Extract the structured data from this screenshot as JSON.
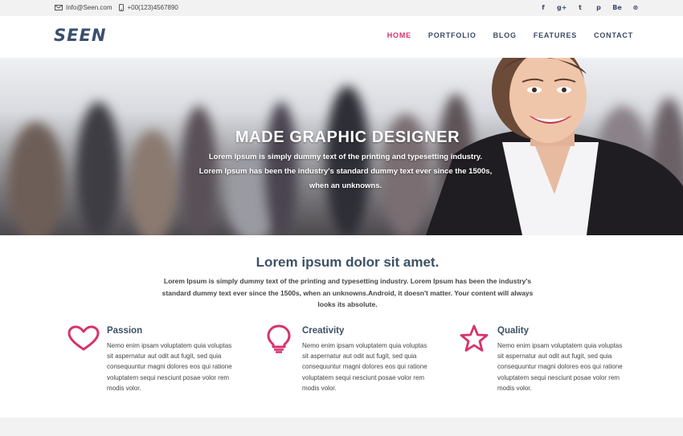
{
  "topbar": {
    "email": "Info@Seen.com",
    "phone": "+00(123)4567890",
    "social": [
      {
        "icon": "facebook-icon",
        "glyph": "f"
      },
      {
        "icon": "google-plus-icon",
        "glyph": "g+"
      },
      {
        "icon": "twitter-icon",
        "glyph": "t"
      },
      {
        "icon": "pinterest-icon",
        "glyph": "p"
      },
      {
        "icon": "behance-icon",
        "glyph": "Be"
      },
      {
        "icon": "dribbble-icon",
        "glyph": "⊛"
      }
    ]
  },
  "header": {
    "logo": "SEEN",
    "nav": [
      "HOME",
      "PORTFOLIO",
      "BLOG",
      "FEATURES",
      "CONTACT"
    ],
    "active_nav": "HOME"
  },
  "hero": {
    "title": "MADE GRAPHIC DESIGNER",
    "line1": "Lorem Ipsum is simply dummy text of the printing and typesetting industry.",
    "line2": "Lorem Ipsum has been the industry's standard dummy text ever since the 1500s,",
    "line3": "when an unknowns."
  },
  "intro": {
    "title": "Lorem ipsum dolor sit amet.",
    "text": "Lorem Ipsum is simply dummy text of the printing and typesetting industry. Lorem Ipsum has been the industry's standard dummy text ever since the 1500s, when an unknowns.Android, it doesn't matter. Your content will always looks its absolute."
  },
  "features": [
    {
      "title": "Passion",
      "icon": "heart-icon",
      "text": "Nemo enim ipsam voluptatem quia voluptas sit aspernatur aut odit aut fugit, sed quia consequuntur magni dolores eos qui ratione voluptatem sequi nesciunt posae volor rem modis volor."
    },
    {
      "title": "Creativity",
      "icon": "lightbulb-icon",
      "text": "Nemo enim ipsam voluptatem quia voluptas sit aspernatur aut odit aut fugit, sed quia consequuntur magni dolores eos qui ratione voluptatem sequi nesciunt posae volor rem modis volor."
    },
    {
      "title": "Quality",
      "icon": "star-icon",
      "text": "Nemo enim ipsam voluptatem quia voluptas sit aspernatur aut odit aut fugit, sed quia consequuntur magni dolores eos qui ratione voluptatem sequi nesciunt posae volor rem modis volor."
    }
  ],
  "colors": {
    "accent": "#d6336c",
    "heading": "#3d5066",
    "nav": "#3b4a63"
  }
}
